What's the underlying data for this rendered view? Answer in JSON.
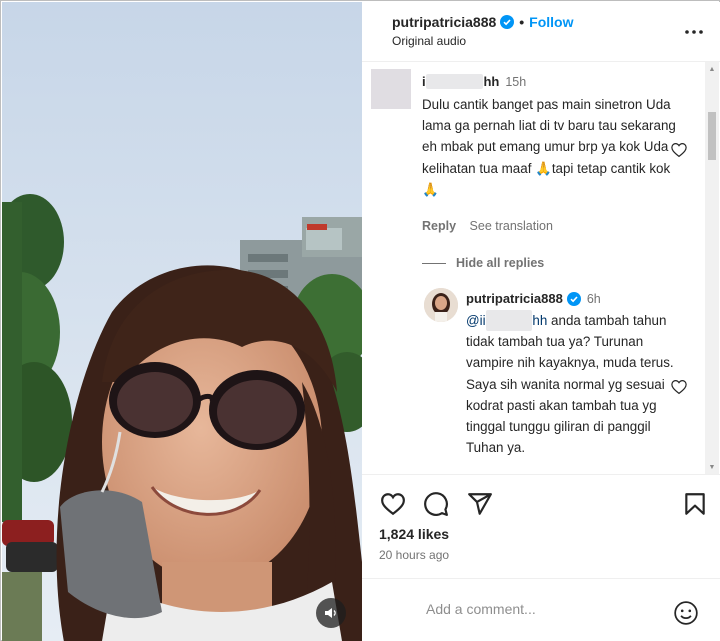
{
  "header": {
    "username": "putripatricia888",
    "separator": "•",
    "follow_label": "Follow",
    "audio_label": "Original audio"
  },
  "comment": {
    "username_start": "i",
    "username_end": "hh",
    "time": "15h",
    "text": "Dulu cantik banget pas main sinetron Uda lama ga pernah liat di tv baru tau sekarang eh mbak put emang umur brp ya kok Uda kelihatan tua maaf 🙏tapi tetap cantik kok🙏",
    "reply_label": "Reply",
    "see_translation_label": "See translation",
    "hide_replies_label": "Hide all replies"
  },
  "reply": {
    "username": "putripatricia888",
    "time": "6h",
    "mention_start": "@ii",
    "mention_end": "hh",
    "text": " anda tambah tahun tidak tambah tua ya? Turunan vampire nih kayaknya, muda terus. Saya sih wanita normal yg sesuai kodrat pasti akan tambah tua yg tinggal tunggu giliran di panggil Tuhan ya."
  },
  "footer": {
    "likes": "1,824 likes",
    "time_ago": "20 hours ago",
    "add_comment_placeholder": "Add a comment..."
  },
  "icons": {
    "verified": "verified-badge-icon",
    "more": "more-options-icon",
    "like": "heart-icon",
    "comment": "comment-icon",
    "share": "share-icon",
    "save": "bookmark-icon",
    "emoji": "emoji-icon",
    "volume": "volume-icon"
  },
  "colors": {
    "accent": "#0095f6",
    "verified": "#0095f6",
    "text": "#262626",
    "secondary": "#737373"
  }
}
